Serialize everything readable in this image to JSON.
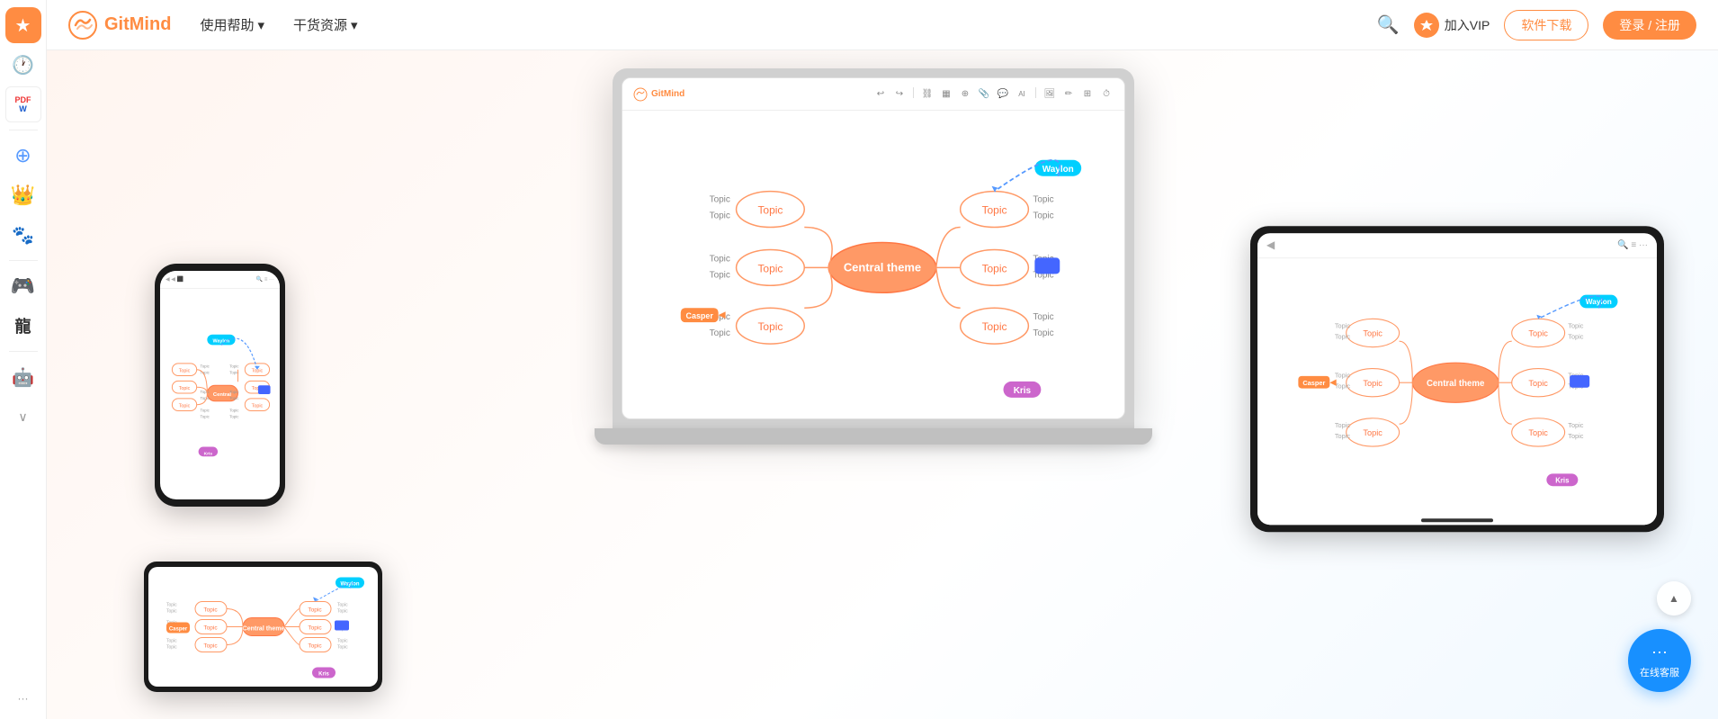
{
  "sidebar": {
    "icons": [
      {
        "id": "star",
        "symbol": "★",
        "active": true
      },
      {
        "id": "clock",
        "symbol": "🕐",
        "active": false
      },
      {
        "id": "pdf-word",
        "symbol": "📄",
        "active": false
      },
      {
        "id": "divider1",
        "type": "divider"
      },
      {
        "id": "share",
        "symbol": "⊕",
        "active": false
      },
      {
        "id": "crown",
        "symbol": "♛",
        "active": false
      },
      {
        "id": "paw",
        "symbol": "🐾",
        "active": false
      },
      {
        "id": "divider2",
        "type": "divider"
      },
      {
        "id": "game",
        "symbol": "🎮",
        "active": false
      },
      {
        "id": "dragon",
        "symbol": "龍",
        "active": false
      },
      {
        "id": "divider3",
        "type": "divider"
      },
      {
        "id": "robot",
        "symbol": "🤖",
        "active": false
      },
      {
        "id": "chevron-down",
        "symbol": "∨",
        "active": false
      },
      {
        "id": "more-dots",
        "symbol": "···",
        "type": "more"
      }
    ]
  },
  "nav": {
    "logo_text": "GitMind",
    "items": [
      {
        "label": "使用帮助",
        "has_arrow": true
      },
      {
        "label": "干货资源",
        "has_arrow": true
      }
    ],
    "search_placeholder": "搜索",
    "vip_label": "加入VIP",
    "download_label": "软件下载",
    "login_label": "登录 / 注册"
  },
  "mindmap": {
    "central_theme": "Central theme",
    "topics": [
      "Topic",
      "Topic",
      "Topic",
      "Topic",
      "Topic",
      "Topic"
    ],
    "labels": [
      "Topic",
      "Topic",
      "Topic",
      "Topic",
      "Topic",
      "Topic",
      "Topic",
      "Topic",
      "Topic",
      "Topic",
      "Topic",
      "Topic"
    ],
    "badges": {
      "waylon": "Waylon",
      "kris": "Kris",
      "casper": "Casper"
    }
  },
  "chat": {
    "icon": "···",
    "label": "在线客服"
  },
  "scroll_up_icon": "▲"
}
